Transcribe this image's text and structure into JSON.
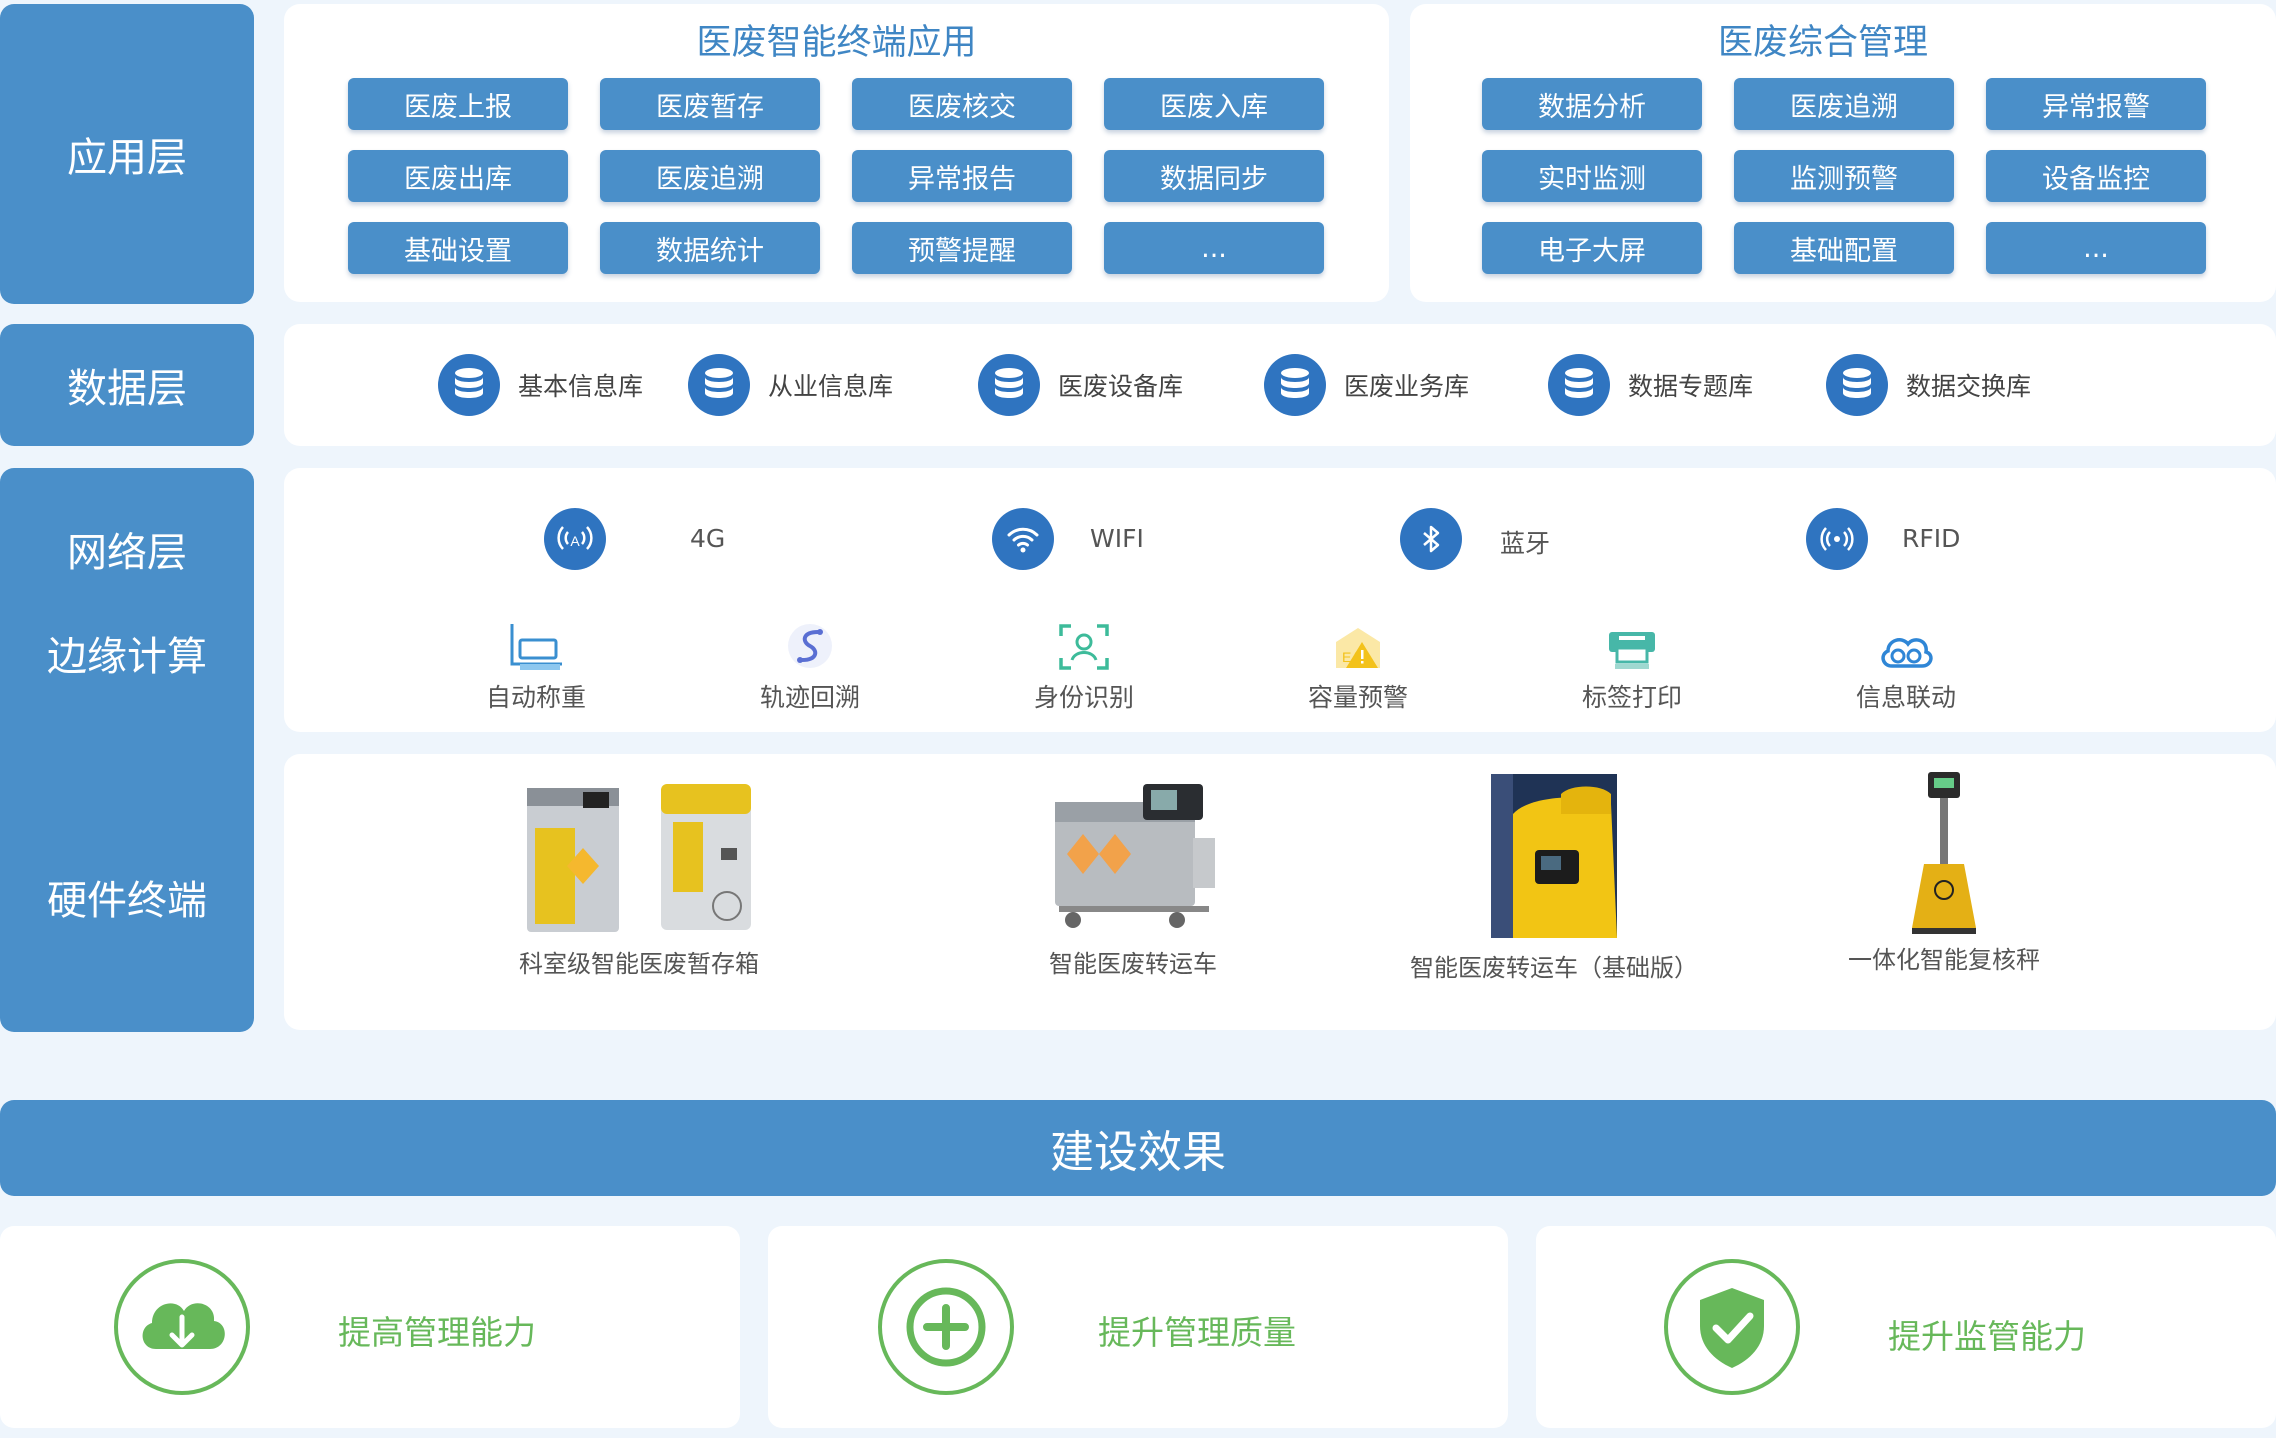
{
  "colors": {
    "primary": "#4a8fc9",
    "dark_blue": "#2f74c0",
    "green": "#67b85a",
    "background": "#eef5fc"
  },
  "layers": {
    "application": "应用层",
    "data": "数据层",
    "network": "网络层",
    "edge": "边缘计算",
    "hardware": "硬件终端"
  },
  "app_terminal": {
    "title": "医废智能终端应用",
    "buttons": [
      "医废上报",
      "医废暂存",
      "医废核交",
      "医废入库",
      "医废出库",
      "医废追溯",
      "异常报告",
      "数据同步",
      "基础设置",
      "数据统计",
      "预警提醒",
      "..."
    ]
  },
  "app_management": {
    "title": "医废综合管理",
    "buttons": [
      "数据分析",
      "医废追溯",
      "异常报警",
      "实时监测",
      "监测预警",
      "设备监控",
      "电子大屏",
      "基础配置",
      "..."
    ]
  },
  "databases": [
    {
      "label": "基本信息库",
      "icon": "database-icon"
    },
    {
      "label": "从业信息库",
      "icon": "database-icon"
    },
    {
      "label": "医废设备库",
      "icon": "database-icon"
    },
    {
      "label": "医废业务库",
      "icon": "database-icon"
    },
    {
      "label": "数据专题库",
      "icon": "database-icon"
    },
    {
      "label": "数据交换库",
      "icon": "database-icon"
    }
  ],
  "network": [
    {
      "label": "4G",
      "icon": "antenna-icon"
    },
    {
      "label": "WIFI",
      "icon": "wifi-icon"
    },
    {
      "label": "蓝牙",
      "icon": "bluetooth-icon"
    },
    {
      "label": "RFID",
      "icon": "rfid-icon"
    }
  ],
  "edge": [
    {
      "label": "自动称重",
      "icon": "scale-icon"
    },
    {
      "label": "轨迹回溯",
      "icon": "route-icon"
    },
    {
      "label": "身份识别",
      "icon": "face-id-icon"
    },
    {
      "label": "容量预警",
      "icon": "warning-icon"
    },
    {
      "label": "标签打印",
      "icon": "printer-icon"
    },
    {
      "label": "信息联动",
      "icon": "cloud-link-icon"
    }
  ],
  "hardware": [
    {
      "label": "科室级智能医废暂存箱",
      "icon": "storage-box-image"
    },
    {
      "label": "智能医废转运车",
      "icon": "transport-cart-image"
    },
    {
      "label": "智能医废转运车（基础版）",
      "icon": "transport-cart-basic-image"
    },
    {
      "label": "一体化智能复核秤",
      "icon": "review-scale-image"
    }
  ],
  "effect": {
    "title": "建设效果",
    "items": [
      {
        "label": "提高管理能力",
        "icon": "cloud-download-icon"
      },
      {
        "label": "提升管理质量",
        "icon": "plus-circle-icon"
      },
      {
        "label": "提升监管能力",
        "icon": "shield-check-icon"
      }
    ]
  }
}
